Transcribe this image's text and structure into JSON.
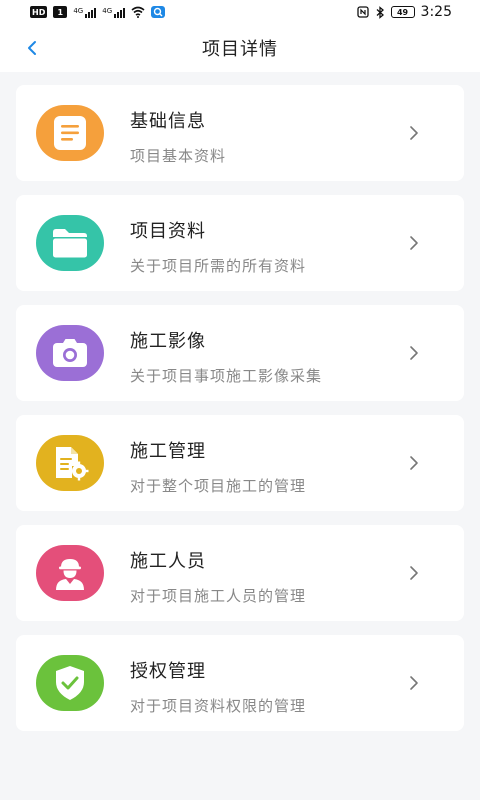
{
  "status_bar": {
    "left_badges": [
      "HD",
      "1"
    ],
    "signal1_label": "4G",
    "signal2_label": "4G",
    "battery": "49",
    "time": "3:25"
  },
  "nav": {
    "title": "项目详情"
  },
  "cards": [
    {
      "title": "基础信息",
      "subtitle": "项目基本资料",
      "icon": "document-icon",
      "color": "#f5a03c"
    },
    {
      "title": "项目资料",
      "subtitle": "关于项目所需的所有资料",
      "icon": "folder-icon",
      "color": "#35c4a8"
    },
    {
      "title": "施工影像",
      "subtitle": "关于项目事项施工影像采集",
      "icon": "camera-icon",
      "color": "#9b6fd6"
    },
    {
      "title": "施工管理",
      "subtitle": "对于整个项目施工的管理",
      "icon": "file-gear-icon",
      "color": "#e2b21f"
    },
    {
      "title": "施工人员",
      "subtitle": "对于项目施工人员的管理",
      "icon": "worker-icon",
      "color": "#e44f7a"
    },
    {
      "title": "授权管理",
      "subtitle": "对于项目资料权限的管理",
      "icon": "shield-check-icon",
      "color": "#6bc23c"
    }
  ]
}
